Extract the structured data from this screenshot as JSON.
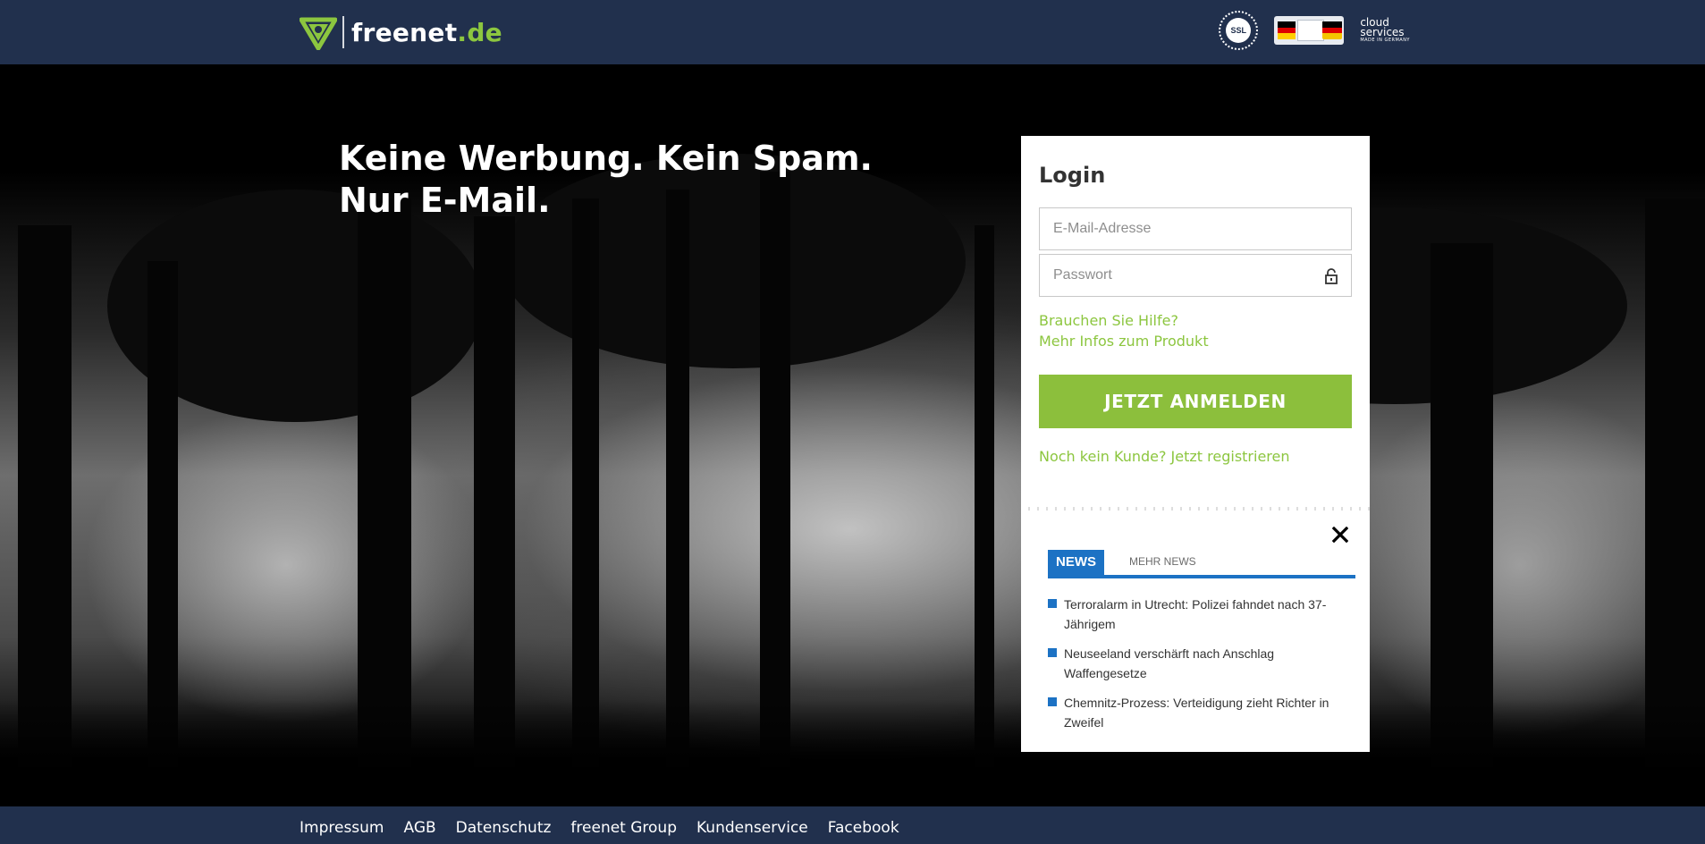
{
  "header": {
    "logo_text_main": "freenet",
    "logo_text_domain": ".de",
    "badges": {
      "ssl": "SSL",
      "cloud_line1": "cloud",
      "cloud_line2": "services",
      "cloud_line3": "MADE IN GERMANY"
    }
  },
  "hero": {
    "headline_line1": "Keine Werbung. Kein Spam.",
    "headline_line2": "Nur E-Mail."
  },
  "login": {
    "title": "Login",
    "email_placeholder": "E-Mail-Adresse",
    "email_value": "",
    "password_placeholder": "Passwort",
    "password_value": "",
    "help_link": "Brauchen Sie Hilfe?",
    "info_link": "Mehr Infos zum Produkt",
    "submit_label": "JETZT ANMELDEN",
    "register_link": "Noch kein Kunde? Jetzt registrieren"
  },
  "news": {
    "tab_active": "NEWS",
    "tab_more": "MEHR NEWS",
    "items": [
      "Terroralarm in Utrecht: Polizei fahndet nach 37-Jährigem",
      "Neuseeland verschärft nach Anschlag Waffengesetze",
      "Chemnitz-Prozess: Verteidigung zieht Richter in Zweifel"
    ]
  },
  "footer": {
    "links": [
      "Impressum",
      "AGB",
      "Datenschutz",
      "freenet Group",
      "Kundenservice",
      "Facebook"
    ]
  },
  "colors": {
    "header_bg": "#21304d",
    "brand_green": "#8cc63f",
    "news_blue": "#1c72c4"
  }
}
